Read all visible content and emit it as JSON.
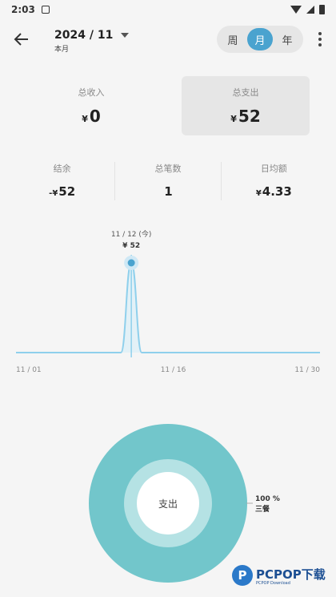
{
  "status_bar": {
    "time": "2:03"
  },
  "header": {
    "date": "2024 / 11",
    "date_sub": "本月"
  },
  "period": {
    "options": [
      "周",
      "月",
      "年"
    ],
    "active_index": 1
  },
  "summary": {
    "income_label": "总收入",
    "income_currency": "¥",
    "income_value": "0",
    "expense_label": "总支出",
    "expense_currency": "¥",
    "expense_value": "52"
  },
  "stats": [
    {
      "label": "结余",
      "prefix": "-¥",
      "value": "52"
    },
    {
      "label": "总笔数",
      "prefix": "",
      "value": "1"
    },
    {
      "label": "日均额",
      "prefix": "¥",
      "value": "4.33"
    }
  ],
  "chart_data": {
    "type": "line",
    "x_tick_labels": [
      "11 / 01",
      "11 / 16",
      "11 / 30"
    ],
    "x": [
      1,
      2,
      3,
      4,
      5,
      6,
      7,
      8,
      9,
      10,
      11,
      12,
      13,
      14,
      15,
      16,
      17,
      18,
      19,
      20,
      21,
      22,
      23,
      24,
      25,
      26,
      27,
      28,
      29,
      30
    ],
    "values": [
      0,
      0,
      0,
      0,
      0,
      0,
      0,
      0,
      0,
      0,
      0,
      52,
      0,
      0,
      0,
      0,
      0,
      0,
      0,
      0,
      0,
      0,
      0,
      0,
      0,
      0,
      0,
      0,
      0,
      0
    ],
    "highlight": {
      "label": "11 / 12 (今)",
      "value_label": "¥ 52",
      "x": 12
    },
    "color": "#8fd0ec",
    "ylim": [
      0,
      52
    ]
  },
  "donut": {
    "center_label": "支出",
    "legend_percent": "100 %",
    "legend_name": "三餐",
    "percent": 100,
    "color_outer": "#72c6cb",
    "color_inner": "#b5e2e4"
  },
  "watermark": {
    "brand": "PCPOP下载",
    "sub": "PCPOP Download",
    "logo_letter": "P"
  },
  "colors": {
    "accent": "#4aa3cf",
    "chart_line": "#8fd0ec"
  }
}
